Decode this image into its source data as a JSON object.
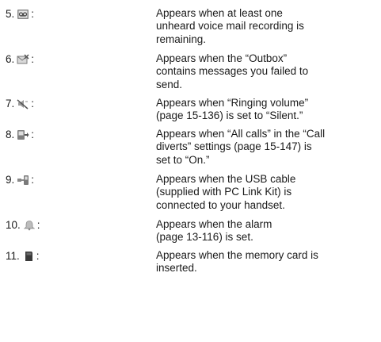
{
  "entries": [
    {
      "number": "5.",
      "icon": "voicemail-icon",
      "separator": ":",
      "lines": [
        "Appears when at least one",
        "unheard voice mail recording is",
        "remaining."
      ]
    },
    {
      "number": "6.",
      "icon": "outbox-failed-icon",
      "separator": ":",
      "lines": [
        "Appears when the “Outbox”",
        "contains messages you failed to",
        "send."
      ]
    },
    {
      "number": "7.",
      "icon": "silent-mode-icon",
      "separator": ":",
      "lines": [
        "Appears when “Ringing volume”",
        "(page 15-136) is set to “Silent.”"
      ]
    },
    {
      "number": "8.",
      "icon": "call-divert-icon",
      "separator": ":",
      "lines": [
        "Appears when “All calls” in the “Call",
        "diverts” settings (page 15-147) is",
        "set to “On.”"
      ]
    },
    {
      "number": "9.",
      "icon": "usb-cable-icon",
      "separator": ":",
      "lines": [
        "Appears when the USB cable",
        "(supplied with PC Link Kit) is",
        "connected to your handset."
      ]
    },
    {
      "number": "10.",
      "icon": "alarm-bell-icon",
      "separator": ":",
      "lines": [
        "Appears when the alarm",
        "(page 13-116) is set."
      ]
    },
    {
      "number": "11.",
      "icon": "memory-card-icon",
      "separator": ":",
      "lines": [
        "Appears when the memory card is",
        "inserted."
      ]
    }
  ]
}
